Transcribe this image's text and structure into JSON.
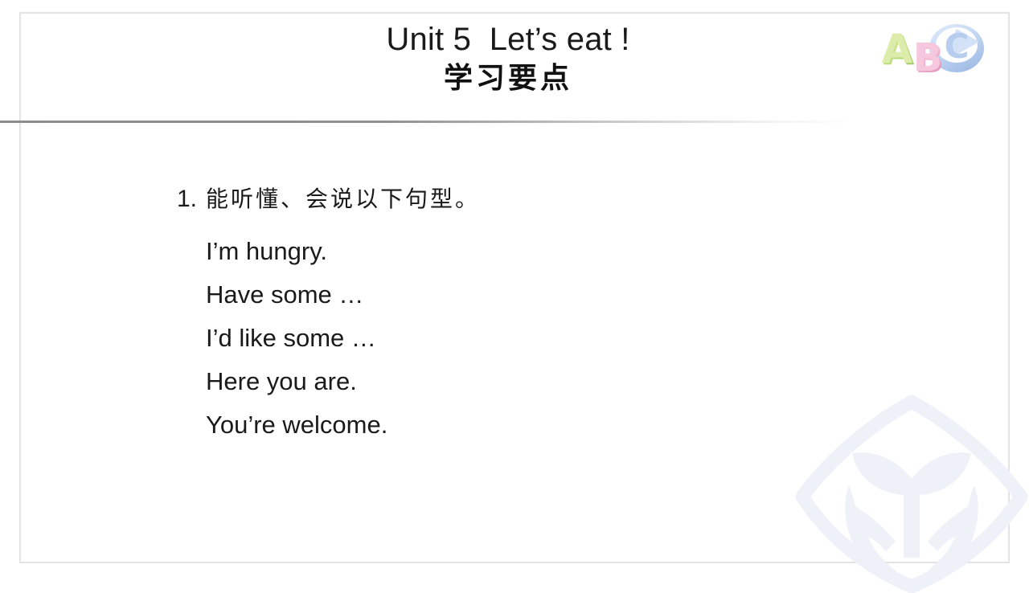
{
  "slide": {
    "background_color": "#ffffff",
    "border_color": "#e3e3e3"
  },
  "header": {
    "title_main": "Unit 5  Let’s eat !",
    "title_sub": "学习要点",
    "rule_color": "#8d8d8d"
  },
  "logo": {
    "name": "abc-blocks-logo",
    "letters": [
      {
        "char": "A",
        "color": "#c6e08a"
      },
      {
        "char": "B",
        "color": "#f3b8d4"
      },
      {
        "char": "C",
        "color": "#c3d6f2"
      }
    ]
  },
  "watermark": {
    "name": "hands-holding-sprout-logo",
    "color": "#eef1f7"
  },
  "content": {
    "points": [
      {
        "number": "1.",
        "text": "能听懂、会说以下句型。",
        "sentences": [
          "I’m hungry.",
          "Have some …",
          "I’d like some …",
          "Here you are.",
          "You’re welcome."
        ]
      }
    ]
  }
}
